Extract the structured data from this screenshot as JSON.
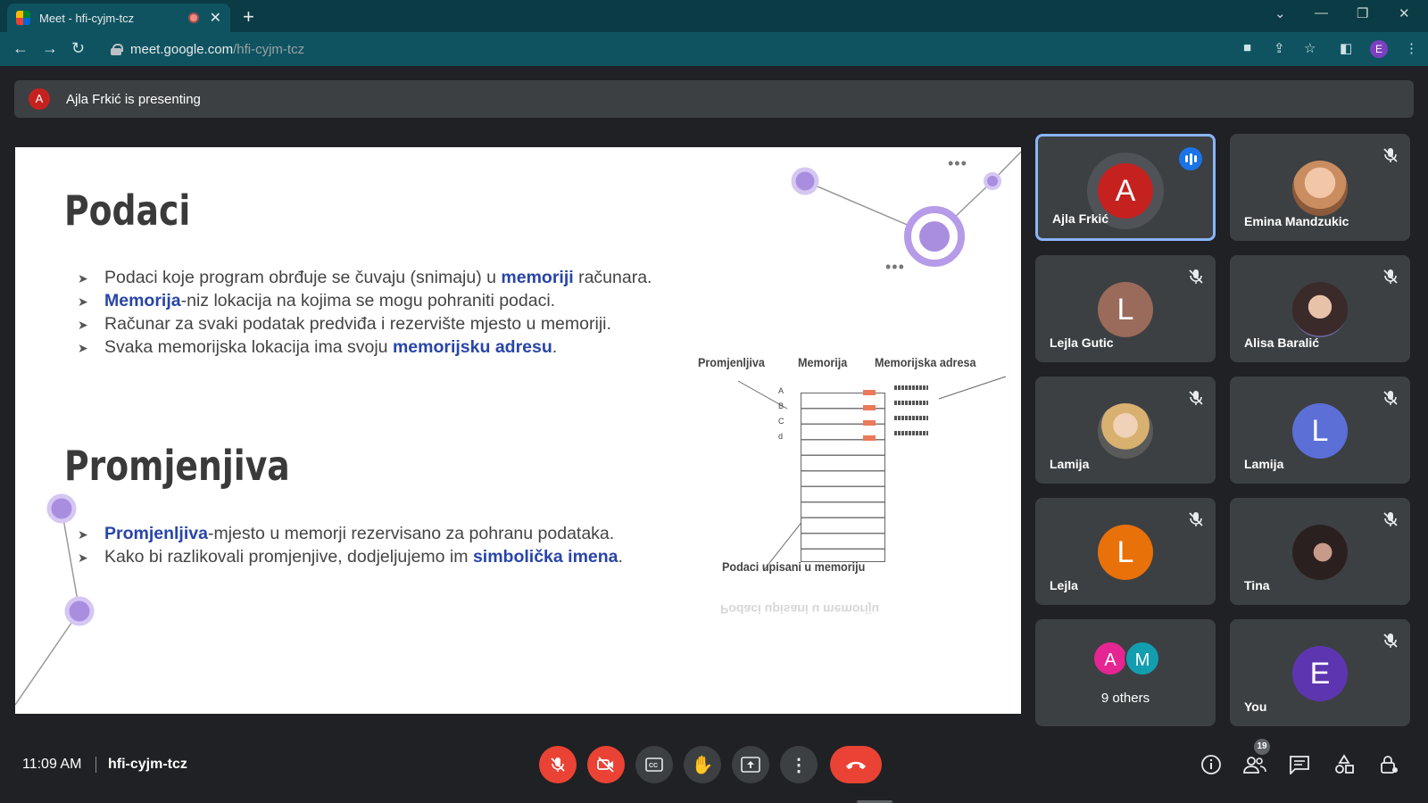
{
  "browser": {
    "tab_title": "Meet - hfi-cyjm-tcz",
    "url_host": "meet.google.com",
    "url_path": "/hfi-cyjm-tcz",
    "profile_initial": "E"
  },
  "banner": {
    "avatar_initial": "A",
    "text": "Ajla Frkić is presenting"
  },
  "slide": {
    "heading1": "Podaci",
    "bullets1": [
      {
        "pre": "Podaci koje program obrđuje se čuvaju (snimaju) u ",
        "hl": "memoriji",
        "post": " računara."
      },
      {
        "pre": "",
        "hl": "Memorija",
        "post": "-niz lokacija na kojima se mogu pohraniti podaci."
      },
      {
        "pre": "Računar za svaki podatak predviđa i rezervište mjesto u memoriji.",
        "hl": "",
        "post": ""
      },
      {
        "pre": "Svaka memorijska lokacija ima svoju ",
        "hl": "memorijsku adresu",
        "post": "."
      }
    ],
    "heading2": "Promjenjiva",
    "bullets2": [
      {
        "pre": "",
        "hl": "Promjenljiva",
        "post": "-mjesto u memorji rezervisano za pohranu podataka."
      },
      {
        "pre": "Kako bi razlikovali promjenjive, dodjeljujemo im ",
        "hl": "simbolička imena",
        "post": "."
      }
    ],
    "diagram": {
      "col1": "Promjenljiva",
      "col2": "Memorija",
      "col3": "Memorijska adresa",
      "caption": "Podaci upisani u memoriju",
      "rows": [
        "A",
        "B",
        "C",
        "d"
      ]
    }
  },
  "participants": [
    {
      "name": "Ajla Frkić",
      "initial": "A",
      "color": "#c5221f",
      "speaking": true
    },
    {
      "name": "Emina Mandzukic",
      "photo": true,
      "muted": true
    },
    {
      "name": "Lejla Gutic",
      "initial": "L",
      "color": "#9a6a5a",
      "muted": true
    },
    {
      "name": "Alisa Baralić",
      "photo": true,
      "muted": true
    },
    {
      "name": "Lamija",
      "photo": true,
      "muted": true
    },
    {
      "name": "Lamija",
      "initial": "L",
      "color": "#5b6fd6",
      "muted": true
    },
    {
      "name": "Lejla",
      "initial": "L",
      "color": "#e8710a",
      "muted": true
    },
    {
      "name": "Tina",
      "photo": true,
      "muted": true
    },
    {
      "name": "9 others",
      "initials": [
        "A",
        "M"
      ],
      "colors": [
        "#e52592",
        "#129eaf"
      ]
    },
    {
      "name": "You",
      "initial": "E",
      "color": "#5e35b1",
      "muted": true
    }
  ],
  "bottom": {
    "time": "11:09 AM",
    "meeting_code": "hfi-cyjm-tcz",
    "people_count": "19"
  }
}
